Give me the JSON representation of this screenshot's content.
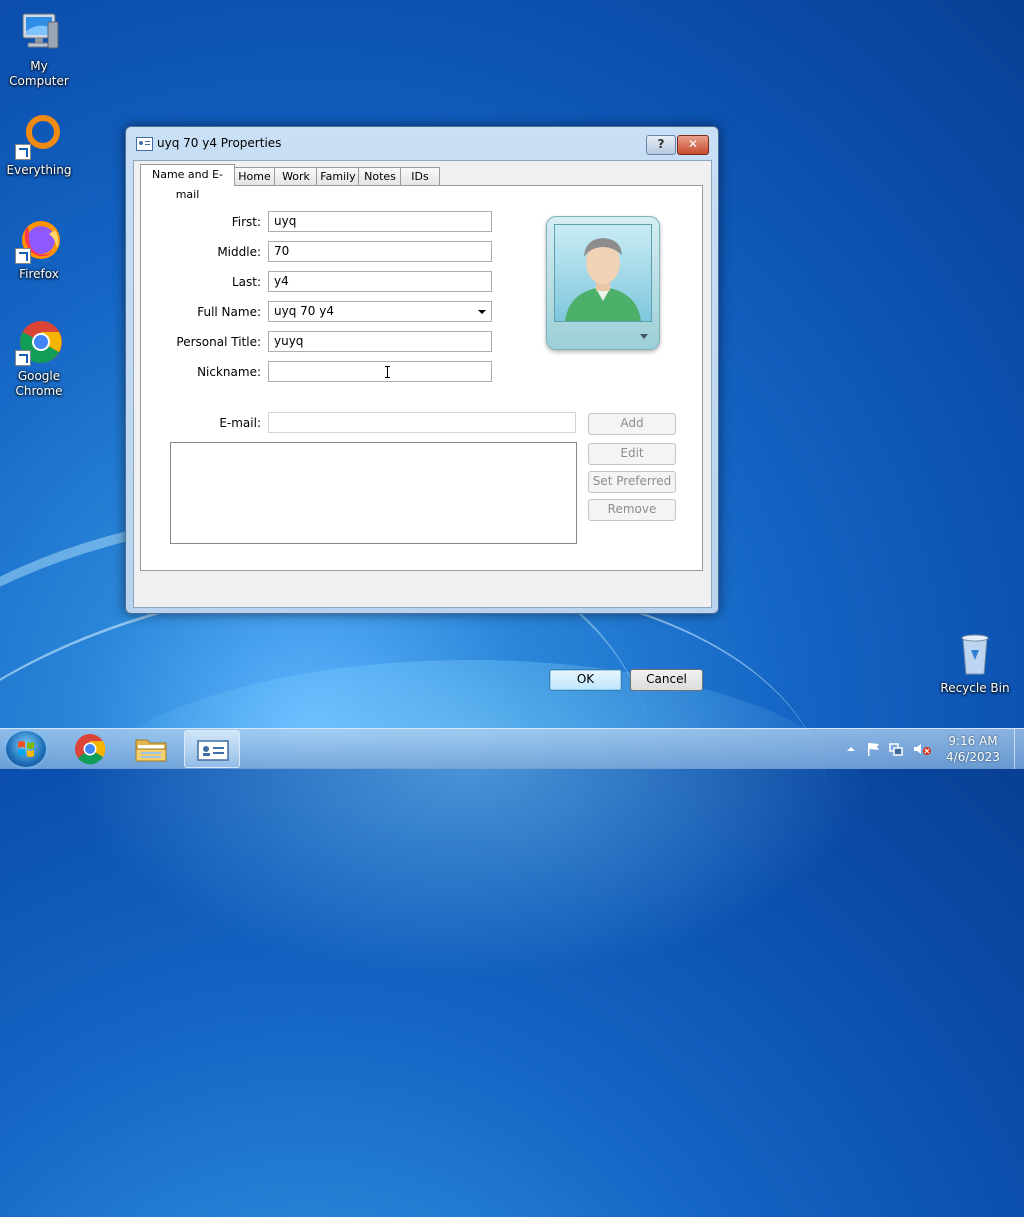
{
  "desktop": {
    "icons": [
      {
        "label": "My Computer"
      },
      {
        "label": "Everything"
      },
      {
        "label": "Firefox"
      },
      {
        "label": "Google Chrome"
      },
      {
        "label": "Recycle Bin"
      }
    ]
  },
  "dialog": {
    "title": "uyq 70 y4 Properties",
    "help_label": "?",
    "close_label": "✕",
    "tabs": [
      {
        "label": "Name and E-mail"
      },
      {
        "label": "Home"
      },
      {
        "label": "Work"
      },
      {
        "label": "Family"
      },
      {
        "label": "Notes"
      },
      {
        "label": "IDs"
      }
    ],
    "fields": {
      "first": {
        "label": "First:",
        "value": "uyq"
      },
      "middle": {
        "label": "Middle:",
        "value": "70"
      },
      "last": {
        "label": "Last:",
        "value": "y4"
      },
      "full_name": {
        "label": "Full Name:",
        "value": "uyq 70 y4"
      },
      "personal_title": {
        "label": "Personal Title:",
        "value": "yuyq"
      },
      "nickname": {
        "label": "Nickname:",
        "value": ""
      },
      "email": {
        "label": "E-mail:",
        "value": ""
      }
    },
    "email_buttons": {
      "add": "Add",
      "edit": "Edit",
      "set_preferred": "Set Preferred",
      "remove": "Remove"
    },
    "ok_label": "OK",
    "cancel_label": "Cancel"
  },
  "taskbar": {
    "time": "9:16 AM",
    "date": "4/6/2023"
  }
}
